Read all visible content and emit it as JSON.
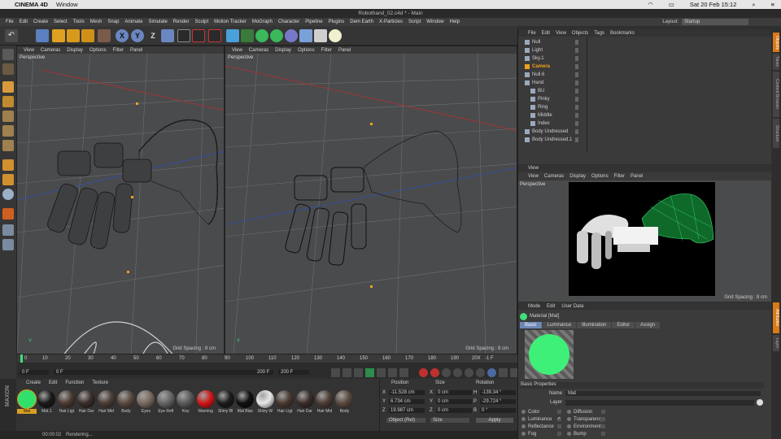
{
  "mac_menu": {
    "app": "CINEMA 4D",
    "items": [
      "Window"
    ],
    "clock": "Sat 20 Feb 15:12"
  },
  "window_title": "Robothand_02.c4d * - Main",
  "app_menu": [
    "File",
    "Edit",
    "Create",
    "Select",
    "Tools",
    "Mesh",
    "Snap",
    "Animate",
    "Simulate",
    "Render",
    "Sculpt",
    "Motion Tracker",
    "MoGraph",
    "Character",
    "Pipeline",
    "Plugins",
    "Dem Earth",
    "X-Particles",
    "Script",
    "Window",
    "Help"
  ],
  "layout": {
    "label": "Layout:",
    "value": "Startup"
  },
  "toolbar_axes": [
    "X",
    "Y",
    "Z"
  ],
  "viewport_menu": [
    "View",
    "Cameras",
    "Display",
    "Options",
    "Filter",
    "Panel"
  ],
  "viewport_left": {
    "label": "Perspective",
    "grid": "Grid Spacing : 8 cm"
  },
  "viewport_right": {
    "label": "Perspective",
    "grid": "Grid Spacing : 8 cm"
  },
  "timeline": {
    "ticks": [
      "0",
      "10",
      "20",
      "30",
      "40",
      "50",
      "60",
      "70",
      "80",
      "90",
      "100",
      "110",
      "120",
      "130",
      "140",
      "150",
      "160",
      "170",
      "180",
      "190",
      "20X"
    ],
    "frame_end_marker": "-1 F",
    "current": "0 F",
    "start": "0 F",
    "end_a": "200 F",
    "end_b": "200 F"
  },
  "material_manager": {
    "menu": [
      "Create",
      "Edit",
      "Function",
      "Texture"
    ],
    "materials": [
      {
        "name": "Mat",
        "color": "#31e06a"
      },
      {
        "name": "Mat.1",
        "color": "#1a1a1a"
      },
      {
        "name": "Hair Ligt",
        "color": "#4a3a32"
      },
      {
        "name": "Hair Dar",
        "color": "#3a2e2a"
      },
      {
        "name": "Hair Mid",
        "color": "#4c3d35"
      },
      {
        "name": "Body",
        "color": "#5a4a3f"
      },
      {
        "name": "Eyes",
        "color": "#7a6b60"
      },
      {
        "name": "Eye Refl",
        "color": "#666666"
      },
      {
        "name": "Key",
        "color": "#5b5b5b"
      },
      {
        "name": "Warning",
        "color": "#d01818"
      },
      {
        "name": "Shiny Bl",
        "color": "#1c1c1c"
      },
      {
        "name": "Mat Blac",
        "color": "#111111"
      },
      {
        "name": "Shiny W",
        "color": "#e8e8e8"
      },
      {
        "name": "Hair Ligt",
        "color": "#4a3a32"
      },
      {
        "name": "Hair Dar",
        "color": "#3a2e2a"
      },
      {
        "name": "Hair Mid",
        "color": "#4c3d35"
      },
      {
        "name": "Body",
        "color": "#5a4a3f"
      }
    ]
  },
  "coordinates": {
    "headers": [
      "Position",
      "Size",
      "Rotation"
    ],
    "rows": [
      {
        "a": "X",
        "pos": "-11.528 cm",
        "b": "X",
        "size": "0 cm",
        "c": "H",
        "rot": "-139.34 °"
      },
      {
        "a": "Y",
        "pos": "6.734 cm",
        "b": "Y",
        "size": "0 cm",
        "c": "P",
        "rot": "-29.724 °"
      },
      {
        "a": "Z",
        "pos": "19.987 cm",
        "b": "Z",
        "size": "0 cm",
        "c": "B",
        "rot": "0 °"
      }
    ],
    "mode": "Object (Rel)",
    "size_mode": "Size",
    "apply": "Apply"
  },
  "status": {
    "time": "00:00:02",
    "text": "Rendering..."
  },
  "object_manager": {
    "menu": [
      "File",
      "Edit",
      "View",
      "Objects",
      "Tags",
      "Bookmarks"
    ],
    "objects": [
      {
        "name": "Null",
        "indent": 0,
        "highlight": false
      },
      {
        "name": "Light",
        "indent": 0,
        "highlight": false
      },
      {
        "name": "Sky.1",
        "indent": 0,
        "highlight": false
      },
      {
        "name": "Camera",
        "indent": 0,
        "highlight": true
      },
      {
        "name": "Null.6",
        "indent": 0,
        "highlight": false
      },
      {
        "name": "Hand",
        "indent": 0,
        "highlight": false
      },
      {
        "name": "BU",
        "indent": 1,
        "highlight": false
      },
      {
        "name": "Pinky",
        "indent": 1,
        "highlight": false
      },
      {
        "name": "Ring",
        "indent": 1,
        "highlight": false
      },
      {
        "name": "Middle",
        "indent": 1,
        "highlight": false
      },
      {
        "name": "Index",
        "indent": 1,
        "highlight": false
      },
      {
        "name": "Body Undressed",
        "indent": 0,
        "highlight": false
      },
      {
        "name": "Body Undressed.1",
        "indent": 0,
        "highlight": false
      }
    ]
  },
  "view_panel": {
    "title": "View",
    "menu": [
      "View",
      "Cameras",
      "Display",
      "Options",
      "Filter",
      "Panel"
    ],
    "label": "Perspective",
    "grid": "Grid Spacing : 8 cm"
  },
  "attributes": {
    "menu": [
      "Mode",
      "Edit",
      "User Data"
    ],
    "object": "Material [Mat]",
    "tabs": [
      "Basic",
      "Luminance",
      "Illumination",
      "Editor",
      "Assign"
    ],
    "section": "Basic Properties",
    "name_label": "Name",
    "name_value": "Mat",
    "layer_label": "Layer",
    "channels_left": [
      "Color",
      "Luminance",
      "Reflectance",
      "Fog"
    ],
    "channels_right": [
      "Diffusion",
      "Transparency",
      "Environment",
      "Bump"
    ]
  },
  "right_strip": [
    "Objects",
    "Takes",
    "Content Browser",
    "Structure",
    "Attributes",
    "Layer"
  ],
  "colors": {
    "accent": "#3fe07a",
    "highlight": "#f0a020",
    "selected_tab": "#6d87b4"
  }
}
